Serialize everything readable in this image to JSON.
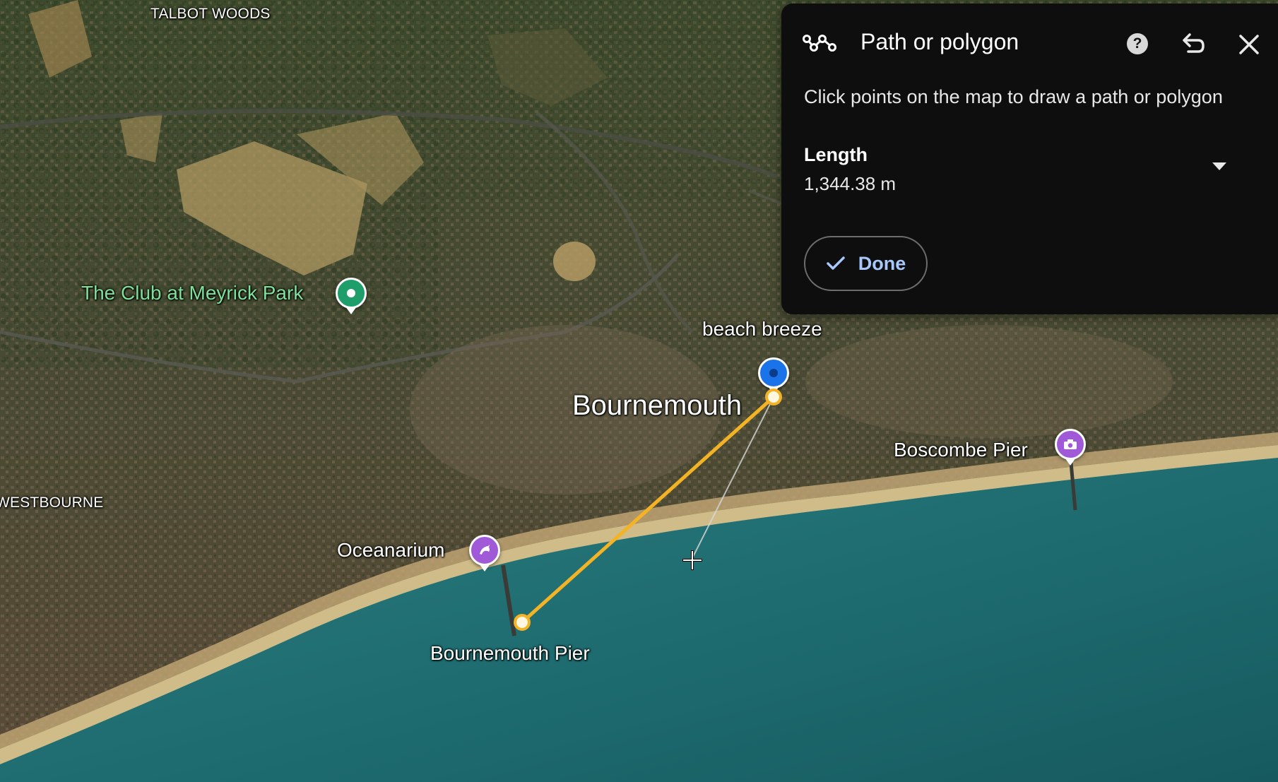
{
  "map": {
    "areas": {
      "talbot_woods": "TALBOT WOODS",
      "westbourne": "WESTBOURNE"
    },
    "city": "Bournemouth",
    "places": {
      "meyrick_park": "The Club at Meyrick Park",
      "beach_breeze": "beach breeze",
      "boscombe_pier": "Boscombe Pier",
      "oceanarium": "Oceanarium",
      "bournemouth_pier": "Bournemouth Pier"
    },
    "colors": {
      "path_line": "#f4b324",
      "pin_green": "#1e9e6b",
      "pin_blue": "#1a73e8",
      "pin_purple": "#a05ad8",
      "sea": "#1f6b70",
      "sand": "#d9c08a"
    },
    "icons": {
      "meyrick_park": "green-pin-icon",
      "beach_breeze": "blue-pin-icon",
      "oceanarium": "dolphin-icon",
      "boscombe_pier": "camera-icon"
    }
  },
  "panel": {
    "title": "Path or polygon",
    "instructions": "Click points on the map to draw a path or polygon",
    "length_label": "Length",
    "length_value": "1,344.38 m",
    "done_label": "Done",
    "icons": [
      "path-icon",
      "help-icon",
      "undo-icon",
      "close-icon",
      "dropdown-arrow-icon",
      "check-icon"
    ]
  }
}
